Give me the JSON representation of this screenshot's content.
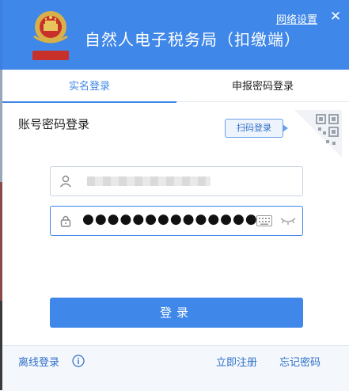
{
  "header": {
    "app_title": "自然人电子税务局（扣缴端）",
    "network_settings": "网络设置",
    "emblem_icon": "national-emblem-icon",
    "close_icon": "close-icon"
  },
  "tabs": [
    {
      "label": "实名登录",
      "active": true
    },
    {
      "label": "申报密码登录",
      "active": false
    }
  ],
  "form": {
    "title": "账号密码登录",
    "qr_scan_label": "扫码登录",
    "username": {
      "icon": "user-icon",
      "value_masked": true
    },
    "password": {
      "icon": "lock-icon",
      "value": "●●●●●●●●●●●●●●",
      "keyboard_icon": "keyboard-icon",
      "eye_icon": "eye-closed-icon"
    },
    "login_label": "登录"
  },
  "footer": {
    "offline_login": "离线登录",
    "info_icon": "info-icon",
    "register": "立即注册",
    "forgot_password": "忘记密码"
  },
  "colors": {
    "primary": "#3f87e8",
    "link": "#2f6fc8",
    "footer_bg": "#f4f8fd"
  }
}
